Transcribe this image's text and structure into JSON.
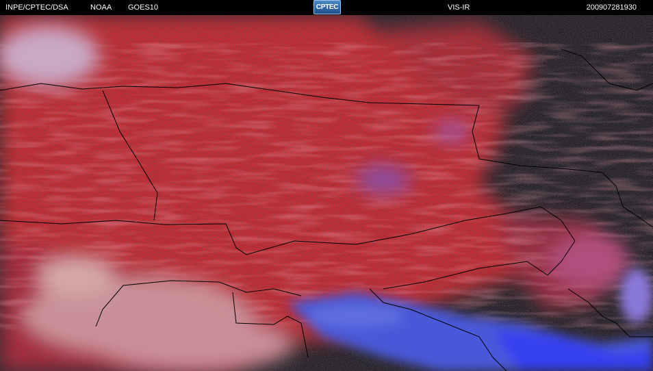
{
  "header": {
    "source": "INPE/CPTEC/DSA",
    "agency": "NOAA",
    "satellite": "GOES10",
    "logo_text": "CPTEC",
    "channel": "VIS-IR",
    "datetime": "200907281930"
  },
  "colors": {
    "header_background": "#000000",
    "header_text": "#ffffff",
    "warm_surface_red": "#d62a30",
    "clear_surface_dark": "#2a2528",
    "cloud_pink": "#d08892",
    "cold_cloud_blue": "#3a4cf0",
    "border_lines": "#000000"
  },
  "icons": {
    "logo": "cptec-logo"
  }
}
